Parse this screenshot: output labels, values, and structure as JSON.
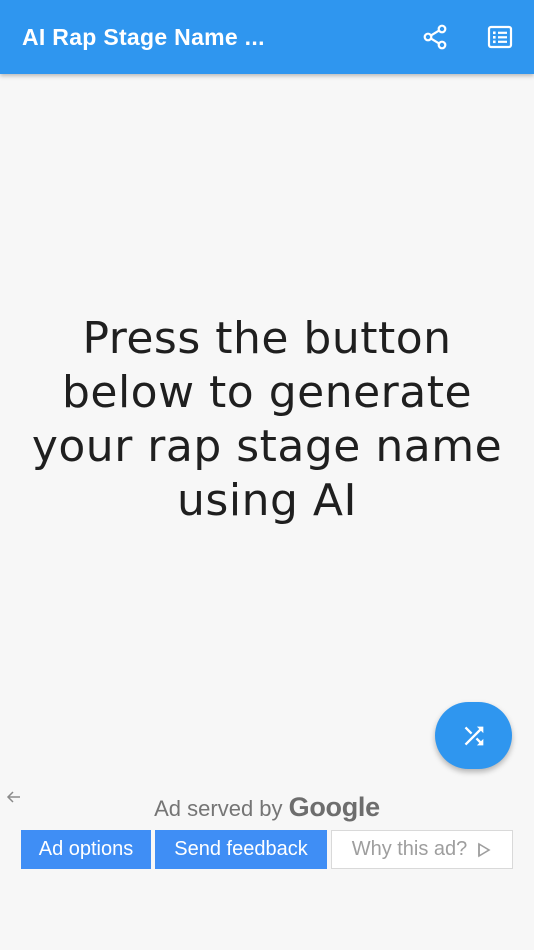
{
  "app_bar": {
    "title": "AI Rap Stage Name ...",
    "share_icon": "share-icon",
    "list_icon": "list-icon",
    "background": "#2f96ef"
  },
  "main": {
    "prompt_lines": [
      "Press the button",
      "below to generate",
      "your rap stage name",
      "using AI"
    ],
    "fab_icon": "shuffle-icon"
  },
  "ad": {
    "served_by": "Ad served by",
    "brand": "Google",
    "options_label": "Ad options",
    "feedback_label": "Send feedback",
    "why_label": "Why this ad?",
    "accent": "#3f8ef5"
  }
}
